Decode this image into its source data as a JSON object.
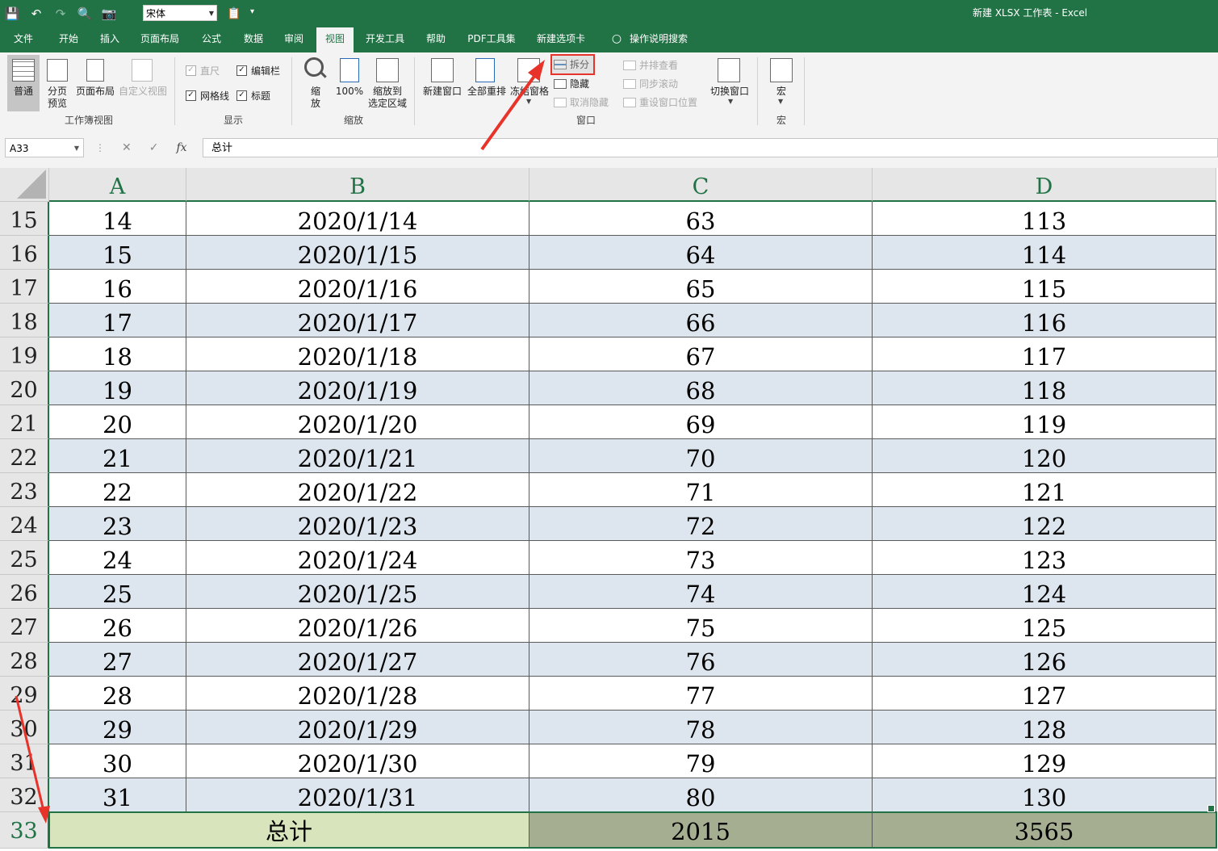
{
  "window": {
    "title": "新建 XLSX 工作表  -  Excel"
  },
  "qat": {
    "font_name": "宋体"
  },
  "tabs": [
    "文件",
    "开始",
    "插入",
    "页面布局",
    "公式",
    "数据",
    "审阅",
    "视图",
    "开发工具",
    "帮助",
    "PDF工具集",
    "新建选项卡",
    "操作说明搜索"
  ],
  "ribbon": {
    "workbook_views": {
      "group": "工作簿视图",
      "normal": "普通",
      "page_break_1": "分页",
      "page_break_2": "预览",
      "page_layout": "页面布局",
      "custom": "自定义视图"
    },
    "show": {
      "group": "显示",
      "ruler": "直尺",
      "formula_bar": "编辑栏",
      "gridlines": "网格线",
      "headings": "标题"
    },
    "zoom": {
      "group": "缩放",
      "zoom_1": "缩",
      "zoom_2": "放",
      "hundred": "100%",
      "to_sel_1": "缩放到",
      "to_sel_2": "选定区域"
    },
    "window": {
      "group": "窗口",
      "new_window": "新建窗口",
      "arrange_all": "全部重排",
      "freeze": "冻结窗格",
      "split": "拆分",
      "hide": "隐藏",
      "unhide": "取消隐藏",
      "side_by_side": "并排查看",
      "sync_scroll": "同步滚动",
      "reset_pos": "重设窗口位置",
      "switch": "切换窗口"
    },
    "macros": {
      "group": "宏",
      "macro": "宏"
    }
  },
  "formula_bar": {
    "name_box": "A33",
    "content": "总计"
  },
  "columns": [
    "A",
    "B",
    "C",
    "D"
  ],
  "rows": [
    {
      "n": "15",
      "a": "14",
      "b": "2020/1/14",
      "c": "63",
      "d": "113"
    },
    {
      "n": "16",
      "a": "15",
      "b": "2020/1/15",
      "c": "64",
      "d": "114"
    },
    {
      "n": "17",
      "a": "16",
      "b": "2020/1/16",
      "c": "65",
      "d": "115"
    },
    {
      "n": "18",
      "a": "17",
      "b": "2020/1/17",
      "c": "66",
      "d": "116"
    },
    {
      "n": "19",
      "a": "18",
      "b": "2020/1/18",
      "c": "67",
      "d": "117"
    },
    {
      "n": "20",
      "a": "19",
      "b": "2020/1/19",
      "c": "68",
      "d": "118"
    },
    {
      "n": "21",
      "a": "20",
      "b": "2020/1/20",
      "c": "69",
      "d": "119"
    },
    {
      "n": "22",
      "a": "21",
      "b": "2020/1/21",
      "c": "70",
      "d": "120"
    },
    {
      "n": "23",
      "a": "22",
      "b": "2020/1/22",
      "c": "71",
      "d": "121"
    },
    {
      "n": "24",
      "a": "23",
      "b": "2020/1/23",
      "c": "72",
      "d": "122"
    },
    {
      "n": "25",
      "a": "24",
      "b": "2020/1/24",
      "c": "73",
      "d": "123"
    },
    {
      "n": "26",
      "a": "25",
      "b": "2020/1/25",
      "c": "74",
      "d": "124"
    },
    {
      "n": "27",
      "a": "26",
      "b": "2020/1/26",
      "c": "75",
      "d": "125"
    },
    {
      "n": "28",
      "a": "27",
      "b": "2020/1/27",
      "c": "76",
      "d": "126"
    },
    {
      "n": "29",
      "a": "28",
      "b": "2020/1/28",
      "c": "77",
      "d": "127"
    },
    {
      "n": "30",
      "a": "29",
      "b": "2020/1/29",
      "c": "78",
      "d": "128"
    },
    {
      "n": "31",
      "a": "30",
      "b": "2020/1/30",
      "c": "79",
      "d": "129"
    },
    {
      "n": "32",
      "a": "31",
      "b": "2020/1/31",
      "c": "80",
      "d": "130"
    }
  ],
  "total_row": {
    "n": "33",
    "label": "总计",
    "c": "2015",
    "d": "3565"
  },
  "colors": {
    "excel_green": "#217346",
    "band": "#dde5ee",
    "total_light": "#d8e4bc",
    "total_dark": "#a6ae92",
    "annotation": "#e8332a"
  }
}
